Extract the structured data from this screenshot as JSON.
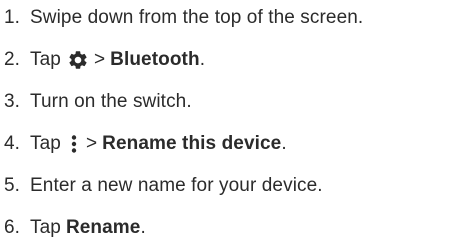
{
  "steps": [
    {
      "number": "1.",
      "text": "Swipe down from the top of the screen."
    },
    {
      "number": "2.",
      "prefix": "Tap",
      "icon": "gear-icon",
      "separator": ">",
      "bold": "Bluetooth",
      "suffix": "."
    },
    {
      "number": "3.",
      "text": "Turn on the switch."
    },
    {
      "number": "4.",
      "prefix": "Tap",
      "icon": "more-vert-icon",
      "separator": ">",
      "bold": "Rename this device",
      "suffix": "."
    },
    {
      "number": "5.",
      "text": "Enter a new name for your device."
    },
    {
      "number": "6.",
      "prefix": "Tap",
      "bold": "Rename",
      "suffix": "."
    }
  ],
  "colors": {
    "text": "#2b2b2b",
    "icon": "#2b2b2b"
  }
}
